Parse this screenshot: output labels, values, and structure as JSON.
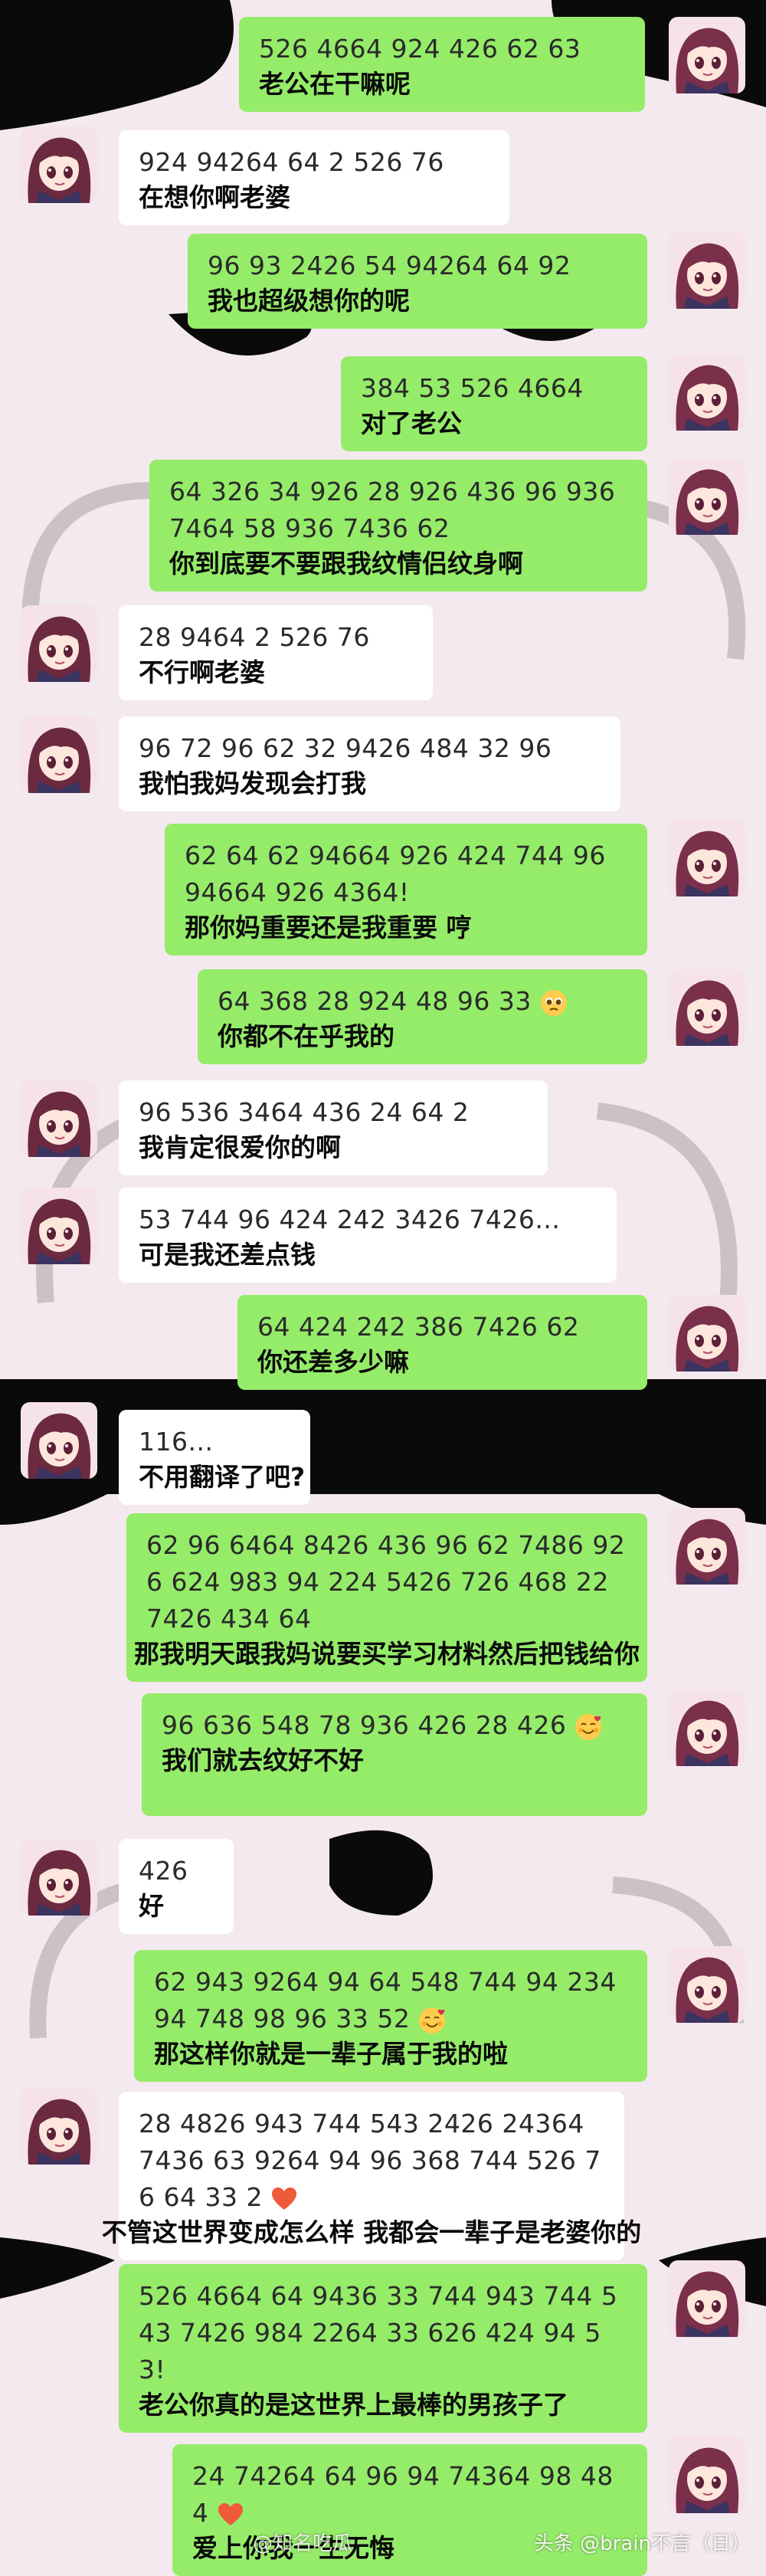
{
  "colors": {
    "self_bubble": "#95ec69",
    "other_bubble": "#ffffff",
    "background": "#f4e9ef"
  },
  "messages": [
    {
      "side": "right",
      "numbers": "526 4664 924 426 62 63",
      "translation": "老公在干嘛呢"
    },
    {
      "side": "left",
      "numbers": "924 94264 64 2 526 76",
      "translation": "在想你啊老婆"
    },
    {
      "side": "right",
      "numbers": "96 93 2426 54 94264 64 92",
      "translation": "我也超级想你的呢"
    },
    {
      "side": "right",
      "numbers": "384 53 526 4664",
      "translation": "对了老公"
    },
    {
      "side": "right",
      "numbers": "64 326 34 926 28 926 436 96 936 7464 58 936 7436 62",
      "translation": "你到底要不要跟我纹情侣纹身啊"
    },
    {
      "side": "left",
      "numbers": "28 9464 2 526 76",
      "translation": "不行啊老婆"
    },
    {
      "side": "left",
      "numbers": "96 72 96 62 32 9426 484 32 96",
      "translation": "我怕我妈发现会打我"
    },
    {
      "side": "right",
      "numbers": "62 64 62 94664 926 424 744 96 94664 926 4364!",
      "translation": "那你妈重要还是我重要 哼"
    },
    {
      "side": "right",
      "numbers": "64 368 28 924 48 96 33",
      "emoji": "pleading-face-emoji",
      "translation": "你都不在乎我的"
    },
    {
      "side": "left",
      "numbers": "96 536 3464 436 24 64 2",
      "translation": "我肯定很爱你的啊"
    },
    {
      "side": "left",
      "numbers": "53 744 96 424 242 3426 7426...",
      "translation": "可是我还差点钱"
    },
    {
      "side": "right",
      "numbers": "64 424 242 386 7426 62",
      "translation": "你还差多少嘛"
    },
    {
      "side": "left",
      "numbers": "116...",
      "translation": "不用翻译了吧?"
    },
    {
      "side": "right",
      "numbers": "62 96 6464 8426 436 96 62 7486 926 624 983 94 224 5426 726 468 22 7426 434 64",
      "translation": "那我明天跟我妈说要买学习材料然后把钱给你"
    },
    {
      "side": "right",
      "numbers": "96 636 548 78 936 426 28 426",
      "emoji": "smiling-hearts-emoji",
      "translation": "我们就去纹好不好"
    },
    {
      "side": "left",
      "numbers": "426",
      "translation": "好"
    },
    {
      "side": "right",
      "numbers": "62 943 9264 94 64 548 744 94 234 94 748 98 96 33 52",
      "emoji": "smiling-hearts-emoji",
      "translation": "那这样你就是一辈子属于我的啦"
    },
    {
      "side": "left",
      "numbers": "28 4826 943 744 543 2426 24364 7436 63 9264 94 96 368 744 526 76 64 33 2",
      "emoji": "heart-emoji",
      "translation": "不管这世界变成怎么样 我都会一辈子是老婆你的"
    },
    {
      "side": "right",
      "numbers": "526 4664 64 9436 33 744 943 744 543 7426 984 2264 33 626 424 94 53!",
      "translation": "老公你真的是这世界上最棒的男孩子了"
    },
    {
      "side": "right",
      "numbers": "24 74264 64 96 94 74364 98 484",
      "emoji": "heart-emoji",
      "translation": "爱上你我一生无悔"
    }
  ],
  "watermarks": {
    "left": "@知名吃瓜",
    "right": "头条 @brain不言（日）"
  }
}
